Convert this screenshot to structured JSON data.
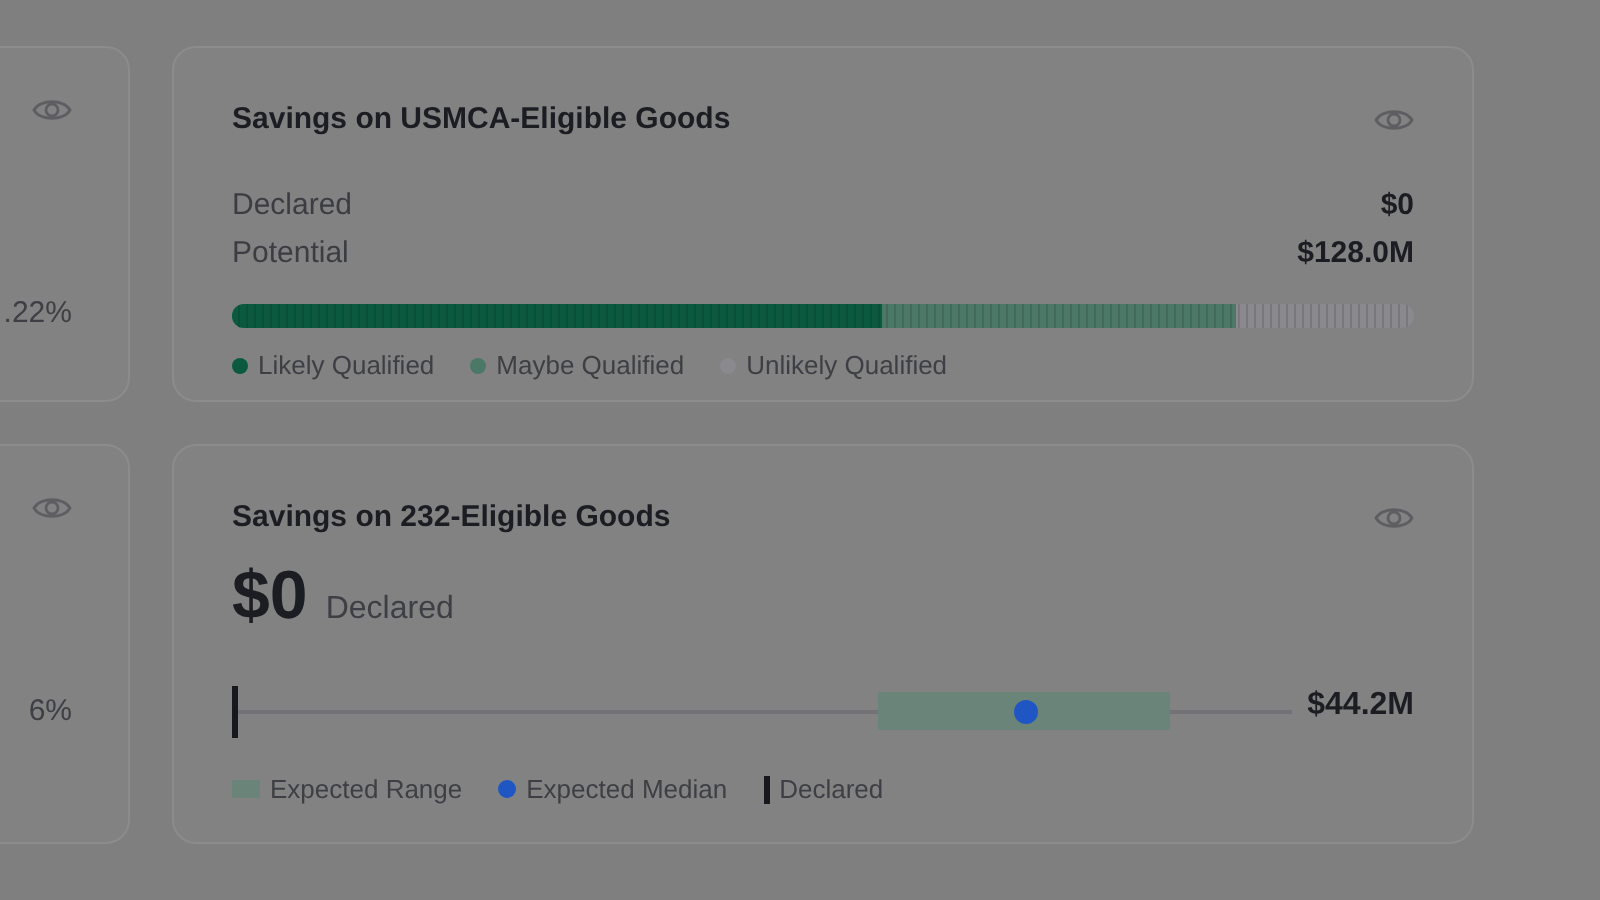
{
  "left_cards": [
    {
      "value": ".22%"
    },
    {
      "value": "6%"
    }
  ],
  "usmca_card": {
    "title": "Savings on USMCA-Eligible Goods",
    "rows": [
      {
        "label": "Declared",
        "value": "$0"
      },
      {
        "label": "Potential",
        "value": "$128.0M"
      }
    ],
    "segments": [
      {
        "label": "Likely Qualified",
        "color": "#0b5a40",
        "level": 0.55
      },
      {
        "label": "Maybe Qualified",
        "color": "#4c7868",
        "level": 0.85
      },
      {
        "label": "Unlikely Qualified",
        "color": "#8a8a8e"
      }
    ]
  },
  "s232_card": {
    "title": "Savings on 232-Eligible Goods",
    "amount": "$0",
    "amount_label": "Declared",
    "max_value": "$44.2M",
    "median": {
      "level": 0.75
    },
    "declared": {
      "level": 0
    },
    "legend": [
      {
        "kind": "range",
        "label": "Expected Range"
      },
      {
        "kind": "median",
        "label": "Expected Median"
      },
      {
        "kind": "declared",
        "label": "Declared"
      }
    ]
  }
}
